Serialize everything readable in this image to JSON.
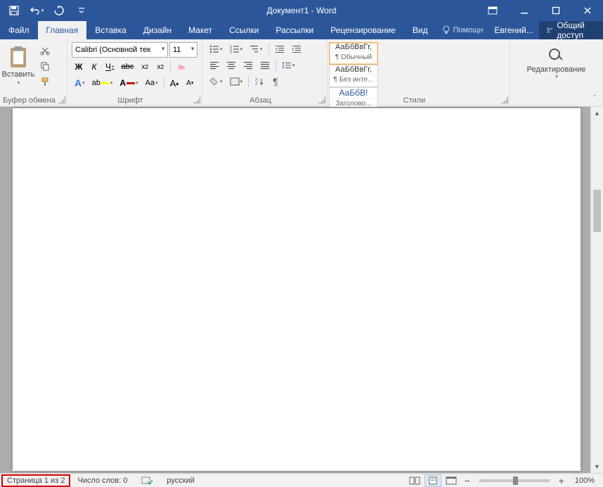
{
  "title": "Документ1 - Word",
  "tabs": {
    "file": "Файл",
    "home": "Главная",
    "insert": "Вставка",
    "design": "Дизайн",
    "layout": "Макет",
    "references": "Ссылки",
    "mailings": "Рассылки",
    "review": "Рецензирование",
    "view": "Вид"
  },
  "tellme": "Помощн",
  "user": "Евгений...",
  "share": "Общий доступ",
  "clipboard": {
    "paste": "Вставить",
    "label": "Буфер обмена"
  },
  "font": {
    "name": "Calibri (Основной тек",
    "size": "11",
    "label": "Шрифт"
  },
  "paragraph": {
    "label": "Абзац"
  },
  "styles": {
    "label": "Стили",
    "items": [
      {
        "preview": "АаБбВвГг,",
        "name": "¶ Обычный"
      },
      {
        "preview": "АаБбВвГг,",
        "name": "¶ Без инте..."
      },
      {
        "preview": "АаБбВ!",
        "name": "Заголово..."
      }
    ]
  },
  "editing": {
    "label": "Редактирование"
  },
  "status": {
    "page": "Страница 1 из 2",
    "words": "Число слов: 0",
    "lang": "русский",
    "zoom": "100%"
  }
}
